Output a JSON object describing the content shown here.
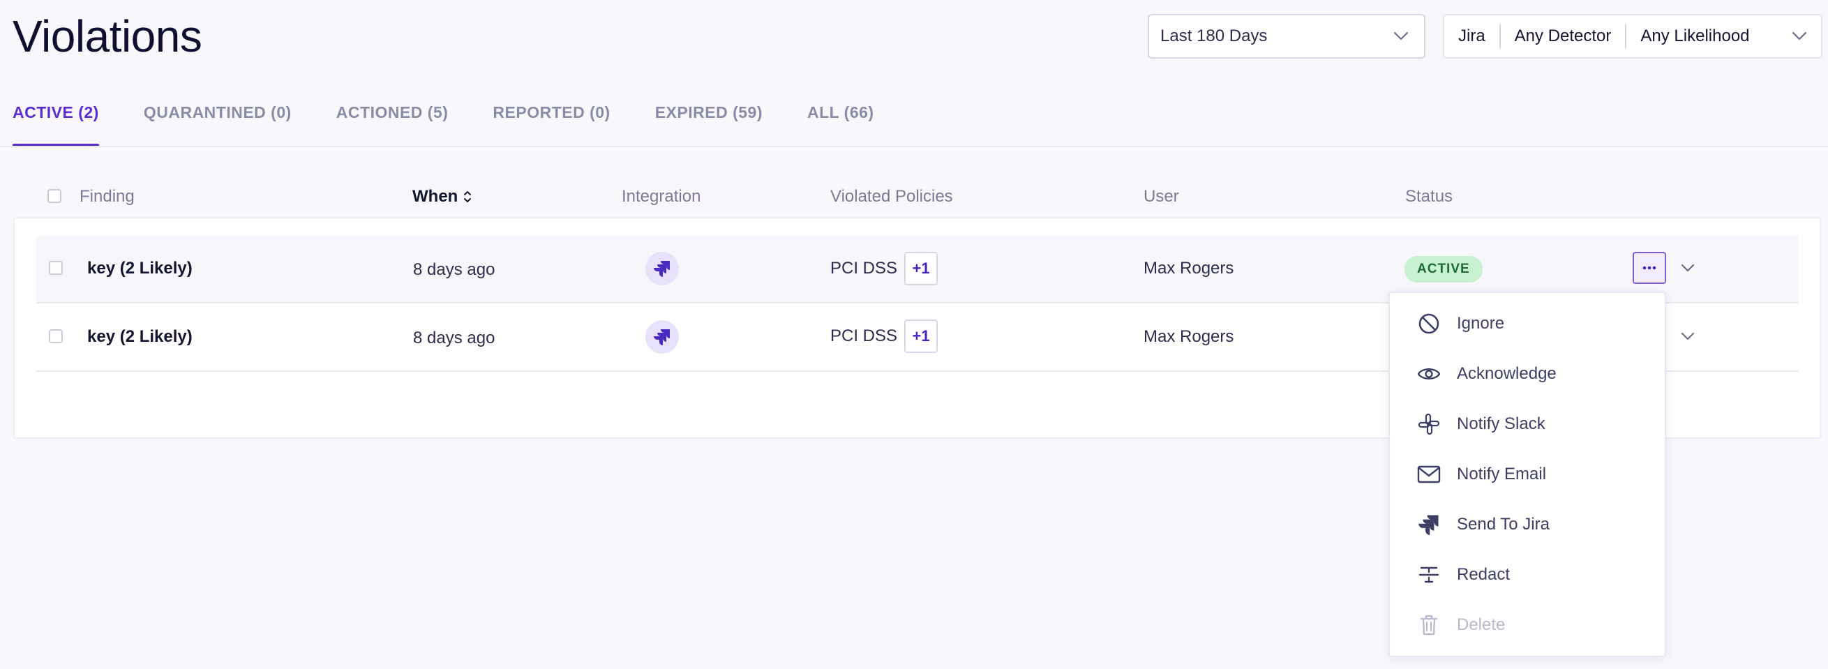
{
  "header": {
    "title": "Violations",
    "date_filter": "Last 180 Days",
    "filters": {
      "integration": "Jira",
      "detector": "Any Detector",
      "likelihood": "Any Likelihood"
    }
  },
  "tabs": [
    {
      "label": "ACTIVE (2)"
    },
    {
      "label": "QUARANTINED (0)"
    },
    {
      "label": "ACTIONED (5)"
    },
    {
      "label": "REPORTED (0)"
    },
    {
      "label": "EXPIRED (59)"
    },
    {
      "label": "ALL (66)"
    }
  ],
  "table": {
    "columns": {
      "finding": "Finding",
      "when": "When",
      "integration": "Integration",
      "policies": "Violated Policies",
      "user": "User",
      "status": "Status"
    },
    "rows": [
      {
        "finding": "key (2 Likely)",
        "when": "8 days ago",
        "integration_icon": "jira-icon",
        "policy": "PCI DSS",
        "extra_policies": "+1",
        "user": "Max Rogers",
        "status": "ACTIVE"
      },
      {
        "finding": "key (2 Likely)",
        "when": "8 days ago",
        "integration_icon": "jira-icon",
        "policy": "PCI DSS",
        "extra_policies": "+1",
        "user": "Max Rogers"
      }
    ]
  },
  "menu": {
    "items": [
      {
        "label": "Ignore",
        "icon": "ban-icon"
      },
      {
        "label": "Acknowledge",
        "icon": "eye-icon"
      },
      {
        "label": "Notify Slack",
        "icon": "slack-icon"
      },
      {
        "label": "Notify Email",
        "icon": "mail-icon"
      },
      {
        "label": "Send To Jira",
        "icon": "jira-icon"
      },
      {
        "label": "Redact",
        "icon": "strikethrough-icon"
      },
      {
        "label": "Delete",
        "icon": "trash-icon",
        "disabled": true
      }
    ]
  },
  "colors": {
    "accent": "#5b2bd4",
    "status_active_bg": "#c9f2d3",
    "status_active_text": "#1d6a33"
  }
}
